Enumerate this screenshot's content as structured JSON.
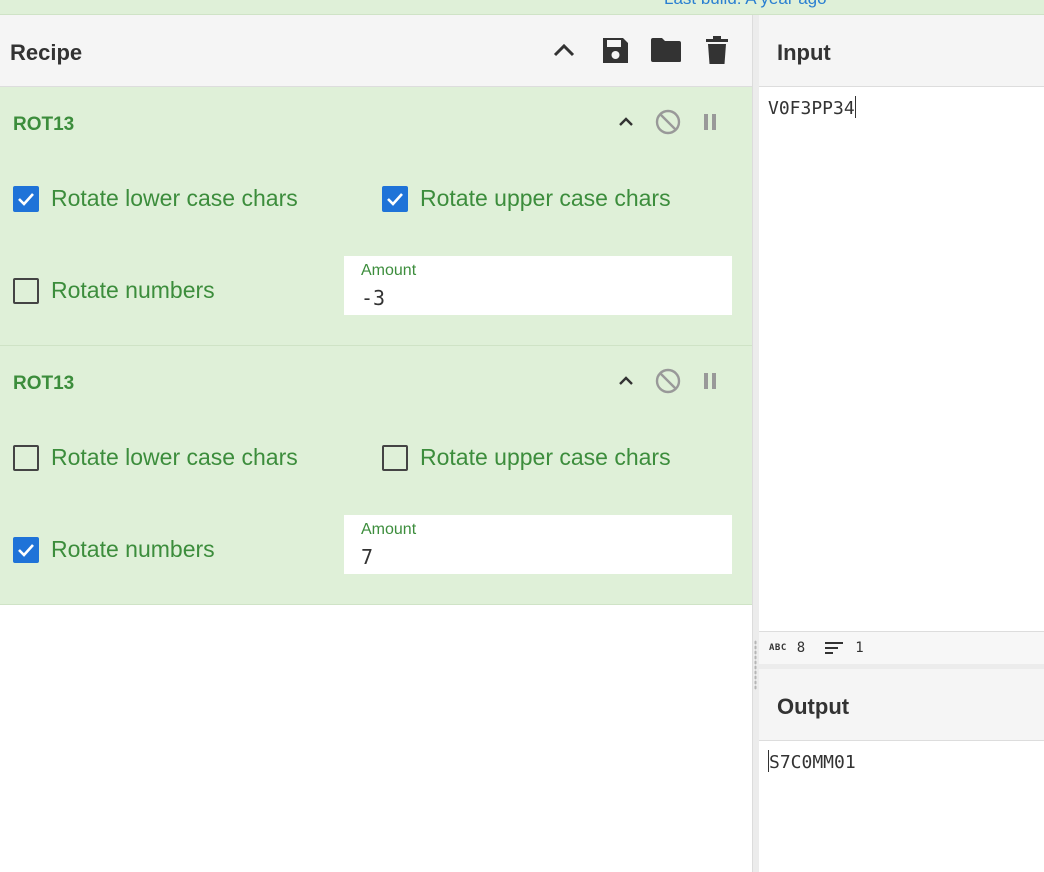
{
  "top_strip": {
    "build_text": "Last build: A year ago"
  },
  "recipe": {
    "title": "Recipe",
    "icons": [
      "chevron-up-icon",
      "save-icon",
      "folder-icon",
      "trash-icon"
    ],
    "operations": [
      {
        "name": "ROT13",
        "rotate_lower": {
          "label": "Rotate lower case chars",
          "checked": true
        },
        "rotate_upper": {
          "label": "Rotate upper case chars",
          "checked": true
        },
        "rotate_numbers": {
          "label": "Rotate numbers",
          "checked": false
        },
        "amount": {
          "label": "Amount",
          "value": "-3"
        }
      },
      {
        "name": "ROT13",
        "rotate_lower": {
          "label": "Rotate lower case chars",
          "checked": false
        },
        "rotate_upper": {
          "label": "Rotate upper case chars",
          "checked": false
        },
        "rotate_numbers": {
          "label": "Rotate numbers",
          "checked": true
        },
        "amount": {
          "label": "Amount",
          "value": "7"
        }
      }
    ]
  },
  "input": {
    "title": "Input",
    "text": "V0F3PP34",
    "status": {
      "chars_icon": "ABC",
      "chars": "8",
      "lines": "1"
    }
  },
  "output": {
    "title": "Output",
    "text": "S7C0MM01"
  },
  "colors": {
    "op_bg": "#dff0d8",
    "op_text": "#3c8d3c",
    "checkbox_on": "#1f73d8",
    "link": "#2a7fd1"
  }
}
